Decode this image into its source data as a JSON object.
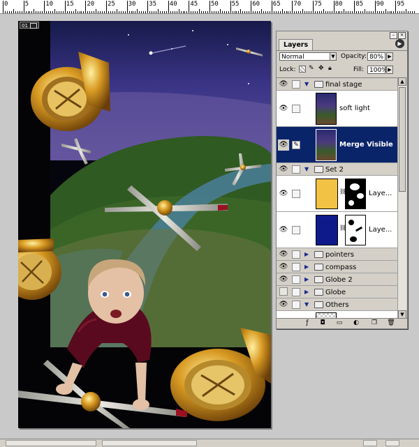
{
  "ruler": {
    "labels": [
      "0",
      "5",
      "10",
      "15",
      "20",
      "25",
      "30",
      "35",
      "40",
      "45",
      "50",
      "55",
      "60",
      "65",
      "70",
      "75",
      "80",
      "85",
      "90",
      "95"
    ]
  },
  "document": {
    "badge_label": "01"
  },
  "layers_panel": {
    "tab_label": "Layers",
    "menu_icon": "palette-menu-arrow-icon",
    "blend_mode": "Normal",
    "opacity_label": "Opacity:",
    "opacity_value": "80%",
    "lock_label": "Lock:",
    "fill_label": "Fill:",
    "fill_value": "100%",
    "layers": [
      {
        "name": "final stage",
        "kind": "set",
        "expanded": true
      },
      {
        "name": "soft light",
        "kind": "layer"
      },
      {
        "name": "Merge Visible",
        "kind": "layer",
        "selected": true
      },
      {
        "name": "Set 2",
        "kind": "set",
        "expanded": true
      },
      {
        "name": "Laye...",
        "kind": "adjustment",
        "thumb_color": "#f2c244"
      },
      {
        "name": "Laye...",
        "kind": "adjustment",
        "thumb_color": "#0e1a8a"
      },
      {
        "name": "pointers",
        "kind": "set",
        "expanded": false
      },
      {
        "name": "compass",
        "kind": "set",
        "expanded": false
      },
      {
        "name": "Globe 2",
        "kind": "set",
        "expanded": false
      },
      {
        "name": "Globe",
        "kind": "set",
        "expanded": false
      },
      {
        "name": "Others",
        "kind": "set",
        "expanded": true
      }
    ]
  },
  "colors": {
    "selection": "#0a246a",
    "panel": "#d4d0c8"
  }
}
